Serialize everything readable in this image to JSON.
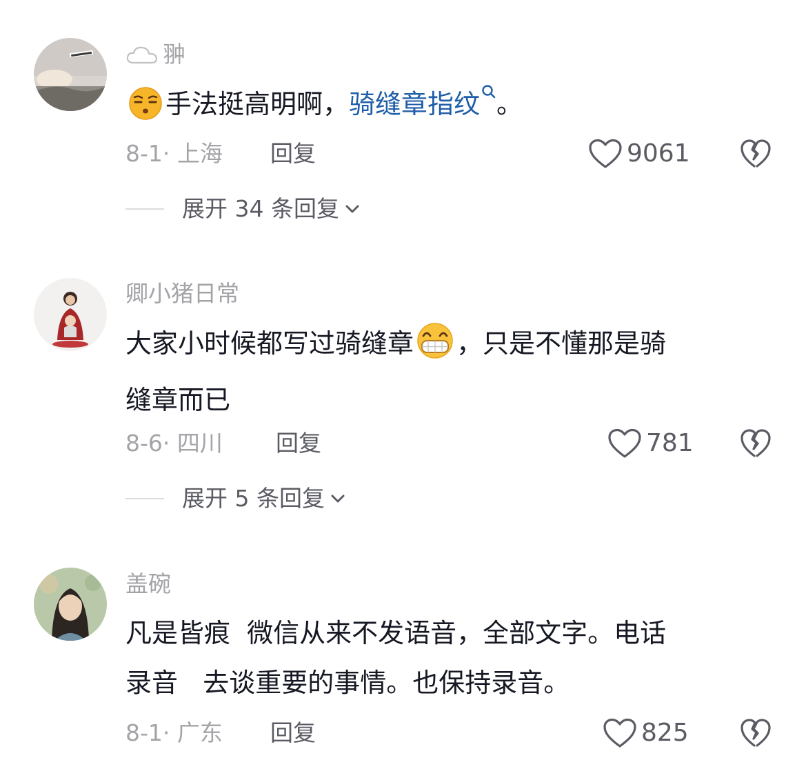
{
  "comments": [
    {
      "username": "翀",
      "badge_icon": "cloud-icon",
      "avatar_icon": "landscape-avatar-icon",
      "leading_emoji": "sleepy-face-emoji",
      "content_text": "手法挺高明啊，",
      "link_text": "骑缝章指纹",
      "link_icon": "search-icon",
      "content_tail": "。",
      "date_location": "8-1· 上海",
      "reply_label": "回复",
      "likes": "9061",
      "expand_label": "展开 34 条回复"
    },
    {
      "username": "卿小猪日常",
      "avatar_icon": "woman-baby-avatar-icon",
      "content_text_1": "大家小时候都写过骑缝章",
      "inline_emoji": "grinning-face-emoji",
      "content_text_2": "，只是不懂那是骑",
      "content_text_3": "缝章而已",
      "date_location": "8-6· 四川",
      "reply_label": "回复",
      "likes": "781",
      "expand_label": "展开 5 条回复"
    },
    {
      "username": "盖碗",
      "avatar_icon": "woman-portrait-avatar-icon",
      "content_line_1": "凡是皆痕  微信从来不发语音，全部文字。电话",
      "content_line_2": "录音   去谈重要的事情。也保持录音。",
      "date_location": "8-1· 广东",
      "reply_label": "回复",
      "likes": "825"
    }
  ],
  "icons": {
    "like": "heart-outline-icon",
    "dislike": "broken-heart-icon",
    "expand": "chevron-down-icon"
  },
  "colors": {
    "text_primary": "#161823",
    "text_secondary": "#a3a3a8",
    "text_action": "#5a5b63",
    "link": "#1f5ea8"
  }
}
